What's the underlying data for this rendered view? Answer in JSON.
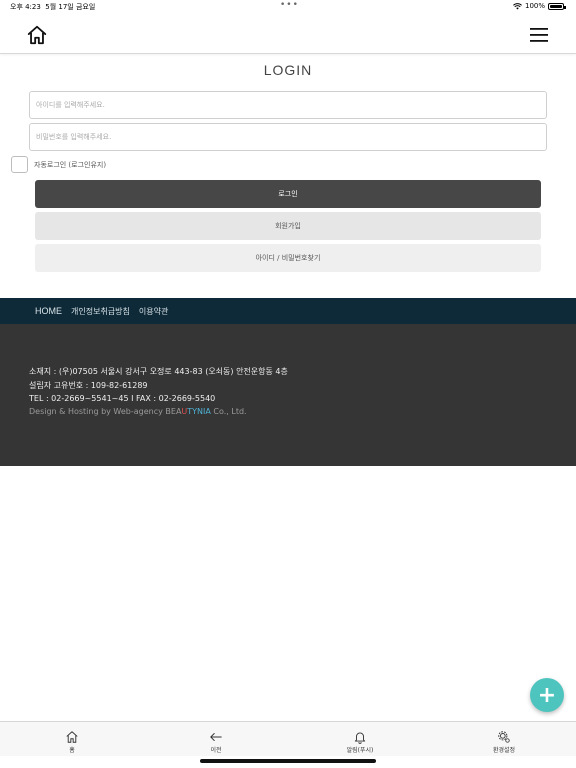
{
  "status_bar": {
    "time": "오후 4:23",
    "date": "5월 17일 금요일",
    "dots": "•••",
    "battery": "100%"
  },
  "header": {
    "home_icon": "home-icon",
    "menu_icon": "hamburger-menu-icon"
  },
  "login": {
    "title": "LOGIN",
    "id_placeholder": "아이디를 입력해주세요.",
    "pw_placeholder": "비밀번호를 입력해주세요.",
    "auto_login_label": "자동로그인 (로그인유지)",
    "login_button": "로그인",
    "join_button": "회원가입",
    "find_button": "아이디 / 비밀번호찾기"
  },
  "footer_nav": {
    "items": [
      "HOME",
      "개인정보취급방침",
      "이용약관"
    ]
  },
  "footer_info": {
    "address": "소재지 : (우)07505 서울시 강서구 오정로 443-83 (오쇠동) 안전운항동 4층",
    "registration": "설립자 고유번호 : 109-82-61289",
    "contact": "TEL : 02-2669~5541~45 I FAX : 02-2669-5540",
    "credit_prefix": "Design & Hosting by Web-agency ",
    "brand_part1": "BEA",
    "brand_part2": "U",
    "brand_part3": "TYNIA",
    "credit_suffix": " Co., Ltd."
  },
  "fab": {
    "label": "+",
    "icon": "plus-icon"
  },
  "tab_bar": {
    "items": [
      {
        "label": "홈",
        "icon": "home-icon"
      },
      {
        "label": "이전",
        "icon": "arrow-left-icon"
      },
      {
        "label": "알림(푸시)",
        "icon": "bell-icon"
      },
      {
        "label": "환경설정",
        "icon": "gear-icon"
      }
    ]
  },
  "colors": {
    "footer_nav_bg": "#0e2a38",
    "footer_info_bg": "#353535",
    "login_button_bg": "#474747",
    "fab_bg": "#4ec4be",
    "brand_red": "#e05050",
    "brand_cyan": "#4fb3d6"
  }
}
